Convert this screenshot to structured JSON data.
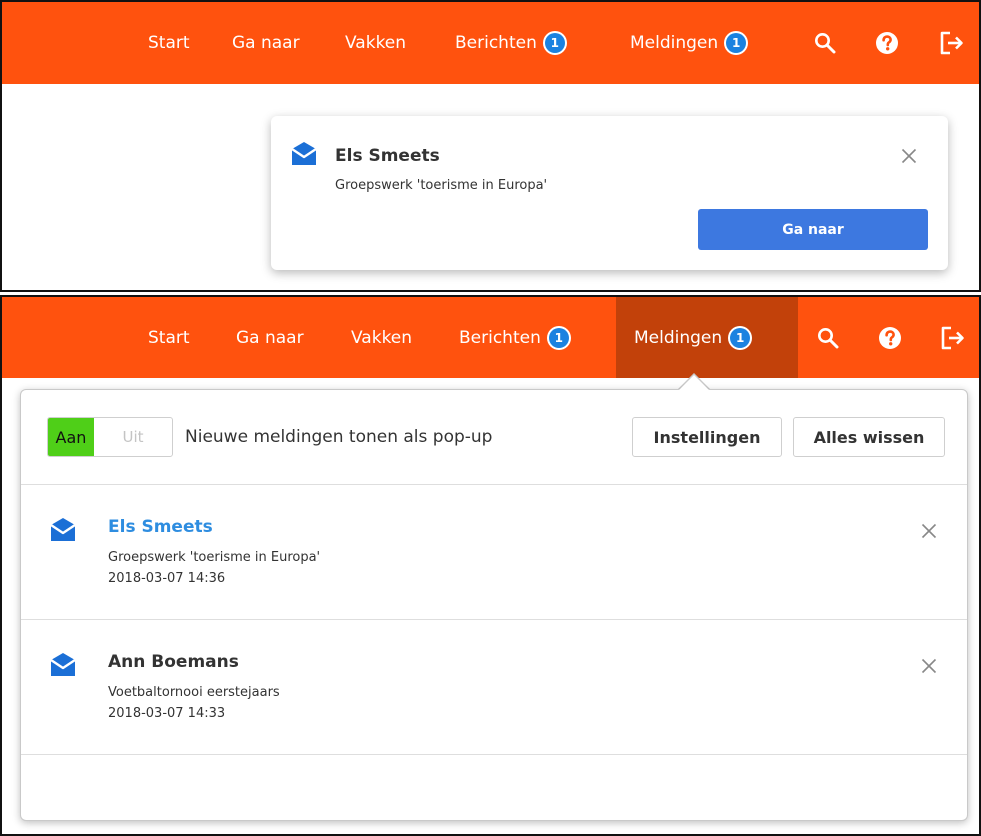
{
  "nav": {
    "start": "Start",
    "ga_naar": "Ga naar",
    "vakken": "Vakken",
    "berichten": "Berichten",
    "berichten_count": "1",
    "meldingen": "Meldingen",
    "meldingen_count": "1",
    "icons": [
      "search-icon",
      "help-icon",
      "logout-icon"
    ]
  },
  "toast": {
    "sender": "Els Smeets",
    "subject": "Groepswerk 'toerisme in Europa'",
    "button_label": "Ga naar"
  },
  "dropdown": {
    "toggle_on": "Aan",
    "toggle_off": "Uit",
    "toggle_label": "Nieuwe meldingen tonen als pop-up",
    "settings_button": "Instellingen",
    "clear_button": "Alles wissen",
    "notifications": [
      {
        "sender": "Els Smeets",
        "subject": "Groepswerk 'toerisme in Europa'",
        "time": "2018-03-07 14:36",
        "unread": true
      },
      {
        "sender": "Ann Boemans",
        "subject": "Voetbaltornooi eerstejaars",
        "time": "2018-03-07 14:33",
        "unread": false
      }
    ]
  },
  "colors": {
    "topbar": "#ff520e",
    "topbar_active": "#c2410a",
    "badge": "#1b82e0",
    "envelope": "#1b6fd6",
    "primary_button": "#3d78e0",
    "toggle_on": "#4fcf18",
    "unread_sender": "#2e8de0"
  }
}
